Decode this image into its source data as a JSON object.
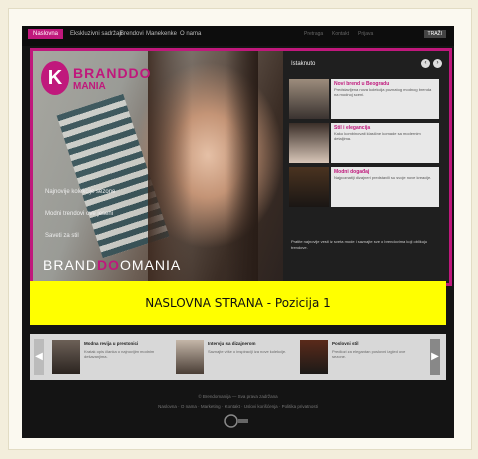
{
  "nav": {
    "items": [
      "Naslovna",
      "Ekskluzivni sadržaji",
      "Brendovi",
      "Manekenke",
      "O nama"
    ],
    "utility": [
      "Pretraga",
      "Kontakt",
      "Prijava"
    ],
    "search_label": "TRAŽI"
  },
  "hero": {
    "logo_letter": "K",
    "logo_text": "BRANDDO",
    "logo_sub": "MANIA",
    "links": [
      "Najnovije kolekcije sezone",
      "Modni trendovi ove jeseni",
      "Saveti za stil"
    ],
    "brand_prefix": "BRAND",
    "brand_mid": "DO",
    "brand_suffix": "OMANIA"
  },
  "sidebar": {
    "title": "Istaknuto",
    "prev": "‹",
    "next": "›",
    "items": [
      {
        "title": "Novi brend u Beogradu",
        "desc": "Predstavljena nova kolekcija poznatog modnog brenda na modnoj sceni."
      },
      {
        "title": "Stil i elegancija",
        "desc": "Kako kombinovati klasične komade sa modernim detaljima."
      },
      {
        "title": "Modni događaj",
        "desc": "Najpoznatiji dizajneri predstavili su svoje nove kreacije."
      }
    ],
    "note": "Pratite najnovije vesti iz sveta mode i saznajte sve o brendovima koji oblikuju trendove."
  },
  "banner": {
    "text": "NASLOVNA STRANA - Pozicija 1"
  },
  "strip": {
    "prev": "◀",
    "next": "▶",
    "cards": [
      {
        "title": "Modna revija u prestonici",
        "desc": "Kratak opis članka o najnovijim modnim dešavanjima."
      },
      {
        "title": "Intervju sa dizajnerom",
        "desc": "Saznajte više o inspiraciji iza nove kolekcije."
      },
      {
        "title": "Poslovni stil",
        "desc": "Predlozi za elegantan poslovni izgled ove sezone."
      }
    ]
  },
  "footer": {
    "line1": "© Brendomanija — Sva prava zadržana",
    "line2": "Naslovna · O nama · Marketing · Kontakt · Uslovi korišćenja · Politika privatnosti"
  },
  "colors": {
    "accent": "#c0187c",
    "banner": "#ffff00",
    "page_bg": "#141414"
  }
}
